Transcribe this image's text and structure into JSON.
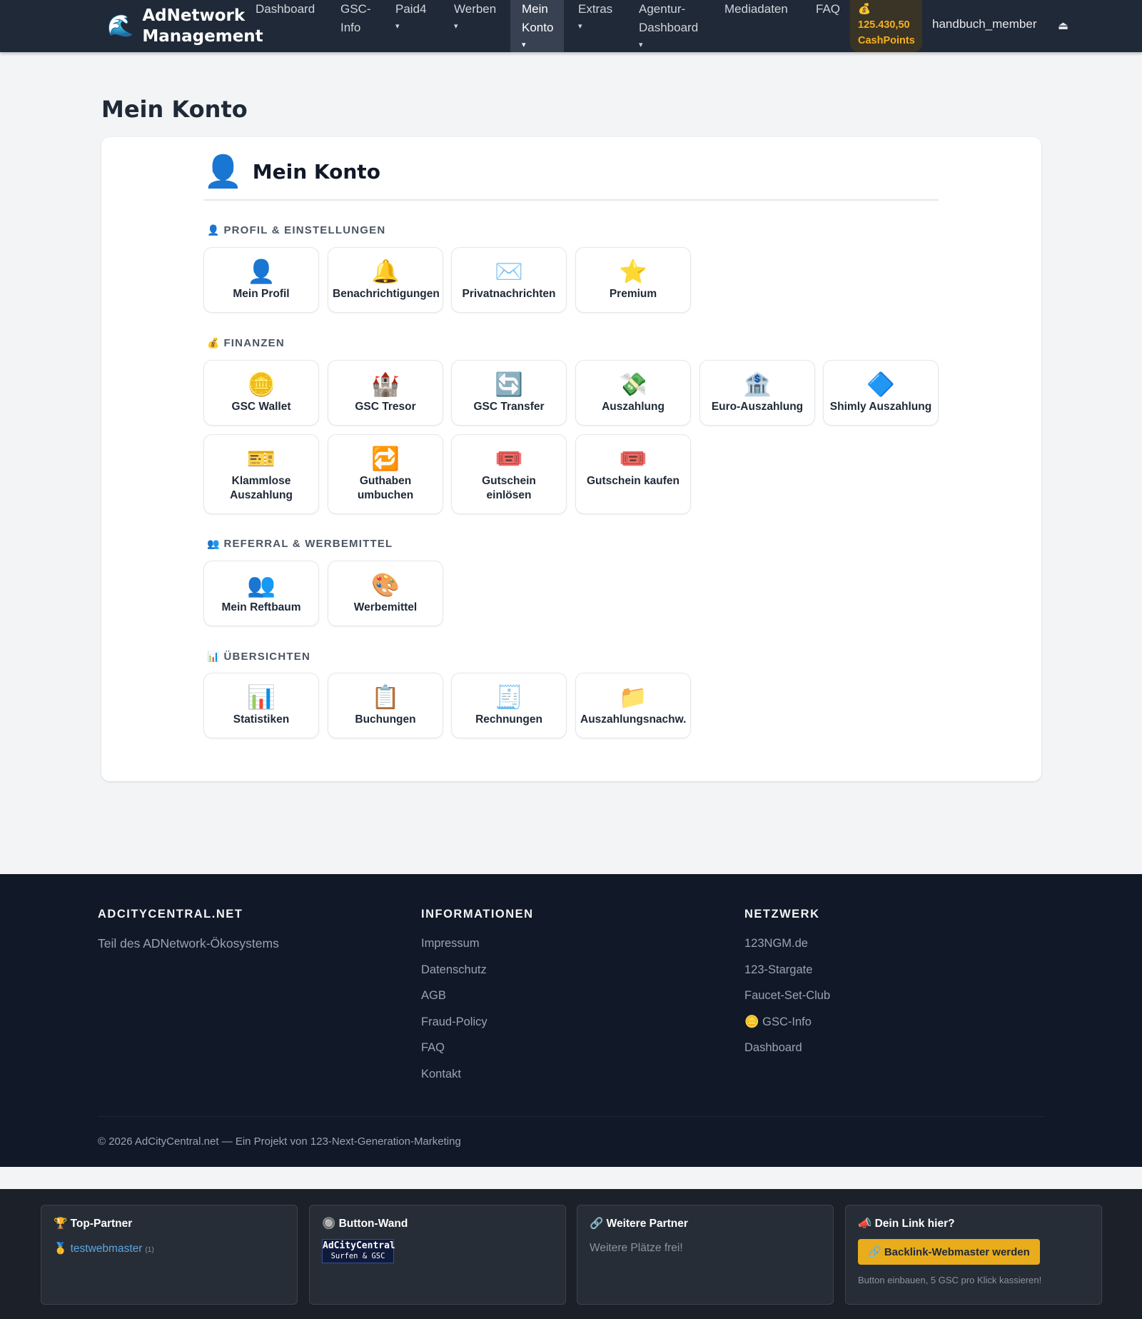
{
  "brand": {
    "logo_icon": "wave-icon",
    "logo_glyph": "🌊",
    "name": "AdNetwork Management"
  },
  "nav": {
    "items": [
      {
        "label": "Dashboard",
        "caret": ""
      },
      {
        "label": "GSC-Info",
        "caret": ""
      },
      {
        "label": "Paid4",
        "caret": "▾"
      },
      {
        "label": "Werben",
        "caret": "▾"
      },
      {
        "label": "Mein Konto",
        "caret": "▾"
      },
      {
        "label": "Extras",
        "caret": "▾"
      },
      {
        "label": "Agentur-Dashboard",
        "caret": "▾"
      },
      {
        "label": "Mediadaten",
        "caret": ""
      },
      {
        "label": "FAQ",
        "caret": ""
      }
    ],
    "active_item": "Mein Konto",
    "cashpoints": {
      "icon": "money-bag-icon",
      "glyph": "💰",
      "value": "125.430,50",
      "unit": "CashPoints"
    },
    "username": "handbuch_member",
    "logout_glyph": "⏏"
  },
  "page": {
    "title": "Mein Konto"
  },
  "card": {
    "title": "Mein Konto",
    "icon_glyph": "👤",
    "sections": [
      {
        "label": "PROFIL & EINSTELLUNGEN",
        "icon_glyph": "👤",
        "tiles": [
          {
            "label": "Mein Profil",
            "glyph": "👤",
            "icon": "user-icon"
          },
          {
            "label": "Benachrichtigungen",
            "glyph": "🔔",
            "icon": "bell-icon"
          },
          {
            "label": "Privatnachrichten",
            "glyph": "✉️",
            "icon": "envelope-icon"
          },
          {
            "label": "Premium",
            "glyph": "⭐",
            "icon": "star-icon"
          }
        ]
      },
      {
        "label": "FINANZEN",
        "icon_glyph": "💰",
        "tiles": [
          {
            "label": "GSC Wallet",
            "glyph": "🪙",
            "icon": "coin-icon"
          },
          {
            "label": "GSC Tresor",
            "glyph": "🏰",
            "icon": "castle-icon"
          },
          {
            "label": "GSC Transfer",
            "glyph": "🔄",
            "icon": "transfer-icon"
          },
          {
            "label": "Auszahlung",
            "glyph": "💸",
            "icon": "money-wings-icon"
          },
          {
            "label": "Euro-Auszahlung",
            "glyph": "🏦",
            "icon": "bank-icon"
          },
          {
            "label": "Shimly Auszahlung",
            "glyph": "🔷",
            "icon": "diamond-icon"
          },
          {
            "label": "Klammlose Auszahlung",
            "glyph": "🎫",
            "icon": "ticket-icon"
          },
          {
            "label": "Guthaben umbuchen",
            "glyph": "🔁",
            "icon": "repeat-icon"
          },
          {
            "label": "Gutschein einlösen",
            "glyph": "🎟️",
            "icon": "voucher-icon"
          },
          {
            "label": "Gutschein kaufen",
            "glyph": "🎟️",
            "icon": "voucher-buy-icon"
          }
        ]
      },
      {
        "label": "REFERRAL & WERBEMITTEL",
        "icon_glyph": "👥",
        "tiles": [
          {
            "label": "Mein Reftbaum",
            "glyph": "👥",
            "icon": "users-icon"
          },
          {
            "label": "Werbemittel",
            "glyph": "🎨",
            "icon": "palette-icon"
          }
        ]
      },
      {
        "label": "ÜBERSICHTEN",
        "icon_glyph": "📊",
        "tiles": [
          {
            "label": "Statistiken",
            "glyph": "📊",
            "icon": "bar-chart-icon"
          },
          {
            "label": "Buchungen",
            "glyph": "📋",
            "icon": "clipboard-icon"
          },
          {
            "label": "Rechnungen",
            "glyph": "🧾",
            "icon": "receipt-icon"
          },
          {
            "label": "Auszahlungsnachw.",
            "glyph": "📁",
            "icon": "folder-icon"
          }
        ]
      }
    ]
  },
  "footer": {
    "col1": {
      "heading": "ADCITYCENTRAL.NET",
      "text": "Teil des ADNetwork-Ökosystems"
    },
    "col2": {
      "heading": "INFORMATIONEN",
      "links": [
        "Impressum",
        "Datenschutz",
        "AGB",
        "Fraud-Policy",
        "FAQ",
        "Kontakt"
      ]
    },
    "col3": {
      "heading": "NETZWERK",
      "links": [
        "123NGM.de",
        "123-Stargate",
        "Faucet-Set-Club",
        "🪙 GSC-Info",
        "Dashboard"
      ]
    },
    "copyright": "© 2026 AdCityCentral.net — Ein Projekt von 123-Next-Generation-Marketing"
  },
  "partners": {
    "top": {
      "title": "🏆 Top-Partner",
      "medal": "🥇",
      "link": "testwebmaster",
      "count": "(1)"
    },
    "wall": {
      "title": "🔘 Button-Wand",
      "button_line1": "AdCityCentral",
      "button_line2": "Surfen & GSC"
    },
    "more": {
      "title": "🔗 Weitere Partner",
      "text": "Weitere Plätze frei!"
    },
    "yours": {
      "title": "📣 Dein Link hier?",
      "button": "🔗 Backlink-Webmaster werden",
      "note": "Button einbauen, 5 GSC pro Klick kassieren!"
    }
  },
  "colors": {
    "nav_bg": "#1f2937",
    "accent_gold": "#e8ac1c",
    "footer_bg": "#111827",
    "link_blue": "#5aa7e0"
  }
}
